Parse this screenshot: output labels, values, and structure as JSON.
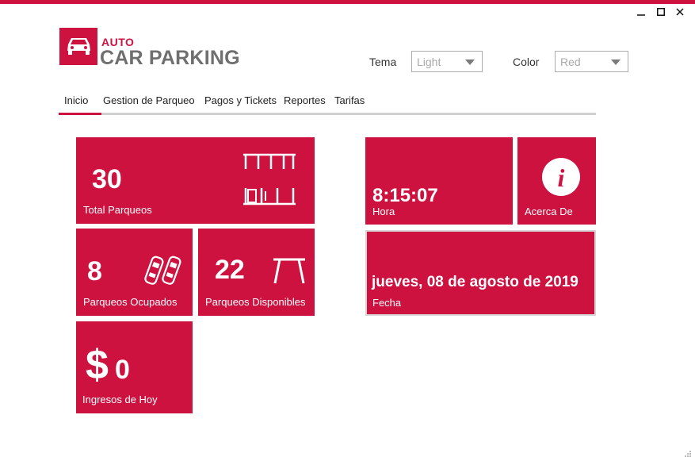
{
  "window": {
    "controls": {
      "minimize": "✕",
      "maximize": "",
      "close": ""
    }
  },
  "logo": {
    "small": "AUTO",
    "big": "CAR PARKING"
  },
  "settings": {
    "tema_label": "Tema",
    "tema_value": "Light",
    "color_label": "Color",
    "color_value": "Red"
  },
  "tabs": [
    {
      "label": "Inicio",
      "active": true
    },
    {
      "label": "Gestion de Parqueo"
    },
    {
      "label": "Pagos y Tickets"
    },
    {
      "label": "Reportes"
    },
    {
      "label": "Tarifas"
    }
  ],
  "tiles": {
    "total": {
      "value": "30",
      "label": "Total Parqueos",
      "icon": "parking-lot-icon"
    },
    "ocupados": {
      "value": "8",
      "label": "Parqueos Ocupados",
      "icon": "parked-cars-icon"
    },
    "disponibles": {
      "value": "22",
      "label": "Parqueos Disponibles",
      "icon": "empty-space-icon"
    },
    "ingresos": {
      "currency": "$",
      "value": "0",
      "label": "Ingresos de Hoy"
    },
    "hora": {
      "value": "8:15:07",
      "label": "Hora"
    },
    "acerca": {
      "label": "Acerca De",
      "icon": "info-icon"
    },
    "fecha": {
      "value": "jueves, 08 de agosto de 2019",
      "label": "Fecha"
    }
  },
  "colors": {
    "accent": "#cd1240",
    "title_gray": "#6f6f6f"
  }
}
